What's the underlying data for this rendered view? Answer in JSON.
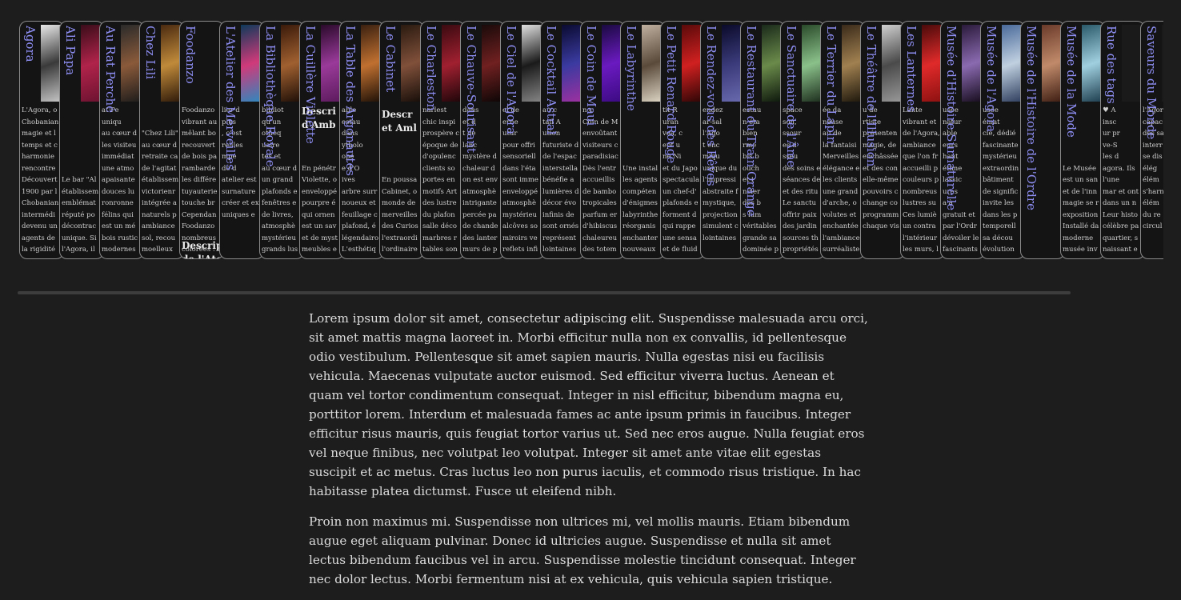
{
  "tabs": [
    {
      "title": "Agora",
      "excerpt": "L'Agora, o\nChobanian\nmagie et l\ntemps et c\nharmonie\nrencontre\nDécouvert\n1900 par l\nChobanian\nintermédi\ndevenu un\nagents de\nla rigidité\ncède la pla\npossibilité",
      "thumb": [
        "#e8e8e8",
        "#3a3a3a",
        "#c9c9c9"
      ]
    },
    {
      "title": "Ali Papa",
      "excerpt": "\n\n\n\n\n\nLe bar \"Al\nétablissem\nemblémat\nréputé po\ndécontrac\nunique. Si\nl'Agora, il\néclectique\nexclusiver",
      "thumb": [
        "#3a0d1a",
        "#b0234a",
        "#6a1230"
      ]
    },
    {
      "title": "Au Rat Perché",
      "excerpt": "at Pe\nuniqu\nau cœur d\nles visiteu\nimmédiat\nune atmo\napaisante\ndouces lu\nronronne\nfélins qui\nest un mé\nbois rustic\nmodernes\nambiance\naccueillan",
      "thumb": [
        "#2a2a2a",
        "#8a5a3a",
        "#1a1a1a"
      ]
    },
    {
      "title": "Chez Lili",
      "excerpt": "\n\n\"Chez Lili\"\nau cœur d\nretraite ca\nde l'agitat\nétablissem\nvictorienr\nintégrée a\nnaturels p\nambiance\nsol, recou\nmoelleux\nforêts, et l\nfeuillage v",
      "thumb": [
        "#4a2a10",
        "#c08a3a",
        "#2a1608"
      ]
    },
    {
      "title": "Foodanzo",
      "excerpt": "Foodanzo\nvibrant au\nmêlant bo\nrecouvert\nde bois pa\nrambarde\nles différe\ntuyauterie\ntouche br\nCependan\nFoodanzo\nnombreus\ncolorées :",
      "thumb": [
        "#141414",
        "#141414",
        "#141414"
      ],
      "heading": "Descrip\nde l'Ate"
    },
    {
      "title": "L'Atelier des Merveilles",
      "excerpt": "lier d\nplus\n, c'est\nreilles\nmpe\nde d\natelier est\nsurnature\ncréer et ex\nuniques e",
      "thumb": [
        "#0e3a5a",
        "#d03a7a",
        "#2a8ac0"
      ]
    },
    {
      "title": "La Bibliothèque Royale",
      "excerpt": "bibliot\nqu'un\nothèq\nuaire\ntes et\nau cœur d\nun grand\nplafonds e\nfenêtres e\nde livres,\natmosphè\nmystérieu\ngrands lus",
      "thumb": [
        "#3a1a0a",
        "#a06030",
        "#1a0c06"
      ]
    },
    {
      "title": "La Cuillère Violette",
      "excerpt": "\n\n\n\n\nEn pénétr\nViolette, o\nenveloppé\npourpre é\nqui ornen\nest un sav\net de myst\nmeubles e\nbanquette\net des lust",
      "thumb": [
        "#2a0a2a",
        "#9a3a9a",
        "#5a1a5a"
      ],
      "heading": "Descri\nd'Amb"
    },
    {
      "title": "La Table des Argonautes",
      "excerpt": "able\nestau\ndans\nytholo\nopé\ne d'O\nives\narbre surr\nnoueux et\nfeuillage c\nplafond, é\nlégendairo\nL'esthétiq\ndomine, a\nagrémente",
      "thumb": [
        "#3a2010",
        "#c07030",
        "#1a0e06"
      ]
    },
    {
      "title": "Le Cabinet",
      "excerpt": "\n\n\n\n\n\nEn poussa\nCabinet, o\nmonde de\nmerveilles\ndes Curios\nl'extraordi\nl'ordinaire\nrecouvert\nd'étagères",
      "thumb": [
        "#2a1a10",
        "#80503a",
        "#140c08"
      ],
      "heading": "Descr\net Aml"
    },
    {
      "title": "Le Charleston",
      "excerpt": "narlest\nchic inspi\nprospère c\népoque de\nd'opulenc\nclients so\nportes en\nmotifs Art\ndes lustre\ndu plafon\nsalle déco\nmarbres r\ntables son\ndressées a",
      "thumb": [
        "#3a0a10",
        "#a02030",
        "#1a0508"
      ]
    },
    {
      "title": "Le Chauve-Sourisant",
      "excerpt": "dans\net d\nt de\nlanc\nmystère d\nchaleur d\non est env\natmosphè\nintrigante\npercée pa\nde chande\ndes lanter\nmurs de p\nornés de t",
      "thumb": [
        "#1a0a0a",
        "#702020",
        "#0a0505"
      ]
    },
    {
      "title": "Le Ciel de l'Agora",
      "excerpt": "el de\nerne\nutur\npour offri\nsensoriell\ndans l'éta\nsont imme\nenveloppé\natmosphè\nmystérieu\nalcôves so\nmiroirs ve\nreflets infi\nprofondeu\nl'espace. L",
      "thumb": [
        "#e0e0e0",
        "#1a1a1a",
        "#888888"
      ]
    },
    {
      "title": "Le Cocktail Astral",
      "excerpt": "au c\ntail A\nution\nfuturiste d\nde l'espac\ninterstella\nbénéfie a\nlumières d\ndécor évo\ninfinis de\nsont ornés\nreprésent\nlointaines\nscintillant\nsolaires e",
      "thumb": [
        "#0a0a30",
        "#3a3aa0",
        "#a030a0"
      ]
    },
    {
      "title": "Le Coin de Maui",
      "excerpt": "n c\nCoin de M\nenvoûtant\nvisiteurs c\nparadisiac\nDès l'entr\naccueillis\nde bambo\ntropicales\nparfum er\nd'hibiscus\nchaleureu\ndes totem",
      "thumb": [
        "#1a0a40",
        "#6a1ac0",
        "#3a0a80"
      ]
    },
    {
      "title": "Le Labyrinthe",
      "excerpt": "\n\n\n\n\nUne instal\nles agents\ncompéten\nd'énigmes\nlabyrinthe\nréorganis\nenchanter\nnouveaux\nLes partic\nnaviguer\nillusions, o",
      "thumb": [
        "#c0b0a0",
        "#5a4a3a",
        "#e0d8c8"
      ]
    },
    {
      "title": "Le Petit Renard Rouge",
      "excerpt": "tit R\nuran\nvea, c\nept u\nne Ni\net du Japo\nspectacula\nun chef-d'\nplafonds e\nforment d\nqui rappe\nune sensa\net de fluid\nmurales à",
      "thumb": [
        "#5a0a0a",
        "#d02020",
        "#2a0505"
      ]
    },
    {
      "title": "Le Rendez-vous des Rêves",
      "excerpt": "endez\nar-sal\nl'Ago\nt enc\nmiqu\nunique du\nl'impressi\nabstraite f\nmystique,\nprojection\nsimulent c\nlointaines",
      "thumb": [
        "#0a0a2a",
        "#3a3a7a",
        "#6a6ab0"
      ]
    },
    {
      "title": "Le Restaurant du Train Orange",
      "excerpt": "estau\nn éta\nbien\nrme\nbis b\nouch\net i\nncier\ndes b\ns lum\nvéritables\ngrande sa\ndominée p\nminiature",
      "thumb": [
        "#1a2a1a",
        "#6a8a4a",
        "#0a140a"
      ]
    },
    {
      "title": "Le Sanctuaire de l'Âme",
      "excerpt": "space\nson,\nssour\nes d\nsseu\ndes soins e\nséances de\net des ritu\nLe sanctu\noffrir paix\ndes jardin\nsources th\npropriétés",
      "thumb": [
        "#2a4a2a",
        "#8ac08a",
        "#1a2a1a"
      ]
    },
    {
      "title": "Le Terrier du Lapin",
      "excerpt": "ée da\nneuse\nau de\nla fantaisi\nMerveilles\nélégance e\nles clients\nune grand\nd'arche, o\nvolutes et\nenchantée\nl'ambiance\nsurréaliste",
      "thumb": [
        "#3a2a1a",
        "#a08050",
        "#1a140a"
      ]
    },
    {
      "title": "Le Théâtre de l'Illusion",
      "excerpt": "u de\nrtiste\nprésenten\nmagie, de\nenchâssée\net des con\nelle-même\npouvoirs c\nchange co\nprogramm\nchaque vis",
      "thumb": [
        "#d0d0d0",
        "#4a4a4a",
        "#9a9a9a"
      ]
    },
    {
      "title": "Les Lanternes",
      "excerpt": "Lante\nvibrant et\nde l'Agora,\nambiance\nque l'on fr\naccueilli p\ncouleurs p\nnombreus\nlustres su\nCes lumiè\nun contra\nl'intérieur\nles murs, l\net les tabo",
      "thumb": [
        "#4a0a0a",
        "#e02a2a",
        "#8a1010"
      ]
    },
    {
      "title": "Musée d'Histoire Surnaturelle",
      "excerpt": "usée\nnatur\nable\neurs\nhant\nétime\nlassic\nures\na à\ngratuit et\npar l'Ordr\ndévoiler le\nfascinants\noffrant un",
      "thumb": [
        "#2a1a3a",
        "#8a6ab0",
        "#140a1a"
      ]
    },
    {
      "title": "Musée de l'Agora",
      "excerpt": "usée\némat\ncle, dédié\nfascinante\nmystérieu\nextraordin\nbâtiment\nde signific\ninvite les\ndans les p\ntemporell\nsa décou\névolution\nbâtiment",
      "thumb": [
        "#4a6a9a",
        "#c0d0e0",
        "#2a3a5a"
      ]
    },
    {
      "title": "Musée de l'Histoire de l'Ordre",
      "excerpt": "",
      "thumb": [
        "#6a3a2a",
        "#c08a6a",
        "#3a1a10"
      ]
    },
    {
      "title": "Musée de la Mode",
      "excerpt": "\n\n\n\n\nLe Musée\nest un san\net de l'inn\nmagie se r\nexposition\nInstallé da\nmoderne\nmusée inv\nexplorer l'\ndes vêtem\naccessoire",
      "thumb": [
        "#2a5a6a",
        "#a0d0e0",
        "#1a3a4a"
      ]
    },
    {
      "title": "Rue des tags",
      "excerpt": "♥ A\ninsc\nur pr\nve-S\nles d\nagora. Ils\nl'une\nmar et ont\ndans un n\nLeur histo\ncélèbre pa\nquartier, s\nnaissant e\nqui peuve\nmême dar\nmystérieu\n\n\"Les Insé\nEmma, T\nSur un ba\ncentral de\ninscription",
      "thumb": [
        "#1a1a1a",
        "#1a1a1a",
        "#1a1a1a"
      ]
    },
    {
      "title": "Saveurs du Monde",
      "excerpt": "l'Agor\ncapac\ndes sa\ninterr\nse dis\nélég\nélém\ns'harn\nélém\ndu re\ncircul",
      "thumb": [
        "#1a1a1a",
        "#1a1a1a",
        "#1a1a1a"
      ]
    }
  ],
  "article": {
    "paragraphs": [
      "Lorem ipsum dolor sit amet, consectetur adipiscing elit. Suspendisse malesuada arcu orci, sit amet mattis magna laoreet in. Morbi efficitur nulla non ex convallis, id pellentesque odio vestibulum. Pellentesque sit amet sapien mauris. Nulla egestas nisi eu facilisis vehicula. Maecenas vulputate auctor euismod. Sed efficitur viverra luctus. Aenean et quam vel tortor condimentum consequat. Integer in nisl efficitur, bibendum magna eu, porttitor lorem. Interdum et malesuada fames ac ante ipsum primis in faucibus. Integer efficitur risus mauris, quis feugiat tortor varius ut. Sed nec eros augue. Nulla feugiat eros vel neque finibus, nec volutpat leo volutpat. Integer sit amet ante vitae elit egestas suscipit et ac metus. Cras luctus leo non purus iaculis, et commodo risus tristique. In hac habitasse platea dictumst. Fusce ut eleifend nibh.",
      "Proin non maximus mi. Suspendisse non ultrices mi, vel mollis mauris. Etiam bibendum augue eget aliquam pulvinar. Donec id ultricies augue. Suspendisse et nulla sit amet lectus bibendum faucibus vel in arcu. Suspendisse molestie tincidunt consequat. Integer nec dolor lectus. Morbi fermentum nisi at ex vehicula, quis vehicula sapien tristique."
    ]
  },
  "colors": {
    "background": "#1d1d1d",
    "tab_title": "#8d8df2",
    "tab_border": "#8a8a8a",
    "text": "#dcdcdc"
  }
}
